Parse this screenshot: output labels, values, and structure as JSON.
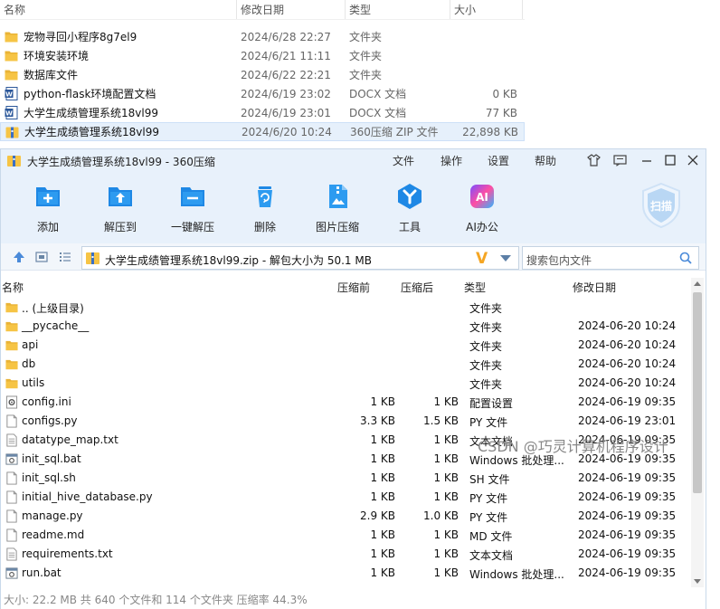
{
  "explorer": {
    "columns": [
      "名称",
      "修改日期",
      "类型",
      "大小"
    ],
    "rows": [
      {
        "name": "宠物寻回小程序8g7el9",
        "date": "2024/6/28 22:27",
        "type": "文件夹",
        "size": "",
        "icon": "folder-icon"
      },
      {
        "name": "环境安装环境",
        "date": "2024/6/21 11:11",
        "type": "文件夹",
        "size": "",
        "icon": "folder-icon"
      },
      {
        "name": "数据库文件",
        "date": "2024/6/22 22:21",
        "type": "文件夹",
        "size": "",
        "icon": "folder-icon"
      },
      {
        "name": "python-flask环境配置文档",
        "date": "2024/6/19 23:02",
        "type": "DOCX 文档",
        "size": "0 KB",
        "icon": "word-doc-icon"
      },
      {
        "name": "大学生成绩管理系统18vl99",
        "date": "2024/6/19 23:01",
        "type": "DOCX 文档",
        "size": "77 KB",
        "icon": "word-doc-icon"
      },
      {
        "name": "大学生成绩管理系统18vl99",
        "date": "2024/6/20 10:24",
        "type": "360压缩 ZIP 文件",
        "size": "22,898 KB",
        "icon": "zip-archive-icon",
        "selected": true
      }
    ]
  },
  "zip_window": {
    "title": "大学生成绩管理系统18vl99 - 360压缩",
    "menus": [
      "文件",
      "操作",
      "设置",
      "帮助"
    ],
    "toolbar": [
      {
        "label": "添加",
        "icon": "add-icon"
      },
      {
        "label": "解压到",
        "icon": "extract-to-icon"
      },
      {
        "label": "一键解压",
        "icon": "one-click-extract-icon"
      },
      {
        "label": "删除",
        "icon": "delete-icon"
      },
      {
        "label": "图片压缩",
        "icon": "image-compress-icon"
      },
      {
        "label": "工具",
        "icon": "tools-icon"
      },
      {
        "label": "AI办公",
        "icon": "ai-office-icon"
      }
    ],
    "scan_label": "扫描",
    "address": "大学生成绩管理系统18vl99.zip - 解包大小为 50.1 MB",
    "search_placeholder": "搜索包内文件",
    "list_columns": [
      "名称",
      "压缩前",
      "压缩后",
      "类型",
      "修改日期"
    ],
    "files": [
      {
        "name": ".. (上级目录)",
        "before": "",
        "after": "",
        "type": "文件夹",
        "date": "",
        "icon": "folder-icon"
      },
      {
        "name": "__pycache__",
        "before": "",
        "after": "",
        "type": "文件夹",
        "date": "2024-06-20 10:24",
        "icon": "folder-icon"
      },
      {
        "name": "api",
        "before": "",
        "after": "",
        "type": "文件夹",
        "date": "2024-06-20 10:24",
        "icon": "folder-icon"
      },
      {
        "name": "db",
        "before": "",
        "after": "",
        "type": "文件夹",
        "date": "2024-06-20 10:24",
        "icon": "folder-icon"
      },
      {
        "name": "utils",
        "before": "",
        "after": "",
        "type": "文件夹",
        "date": "2024-06-20 10:24",
        "icon": "folder-icon"
      },
      {
        "name": "config.ini",
        "before": "1 KB",
        "after": "1 KB",
        "type": "配置设置",
        "date": "2024-06-19 09:35",
        "icon": "config-file-icon"
      },
      {
        "name": "configs.py",
        "before": "3.3 KB",
        "after": "1.5 KB",
        "type": "PY 文件",
        "date": "2024-06-19 23:01",
        "icon": "file-icon"
      },
      {
        "name": "datatype_map.txt",
        "before": "1 KB",
        "after": "1 KB",
        "type": "文本文档",
        "date": "2024-06-19 09:35",
        "icon": "text-file-icon"
      },
      {
        "name": "init_sql.bat",
        "before": "1 KB",
        "after": "1 KB",
        "type": "Windows 批处理...",
        "date": "2024-06-19 09:35",
        "icon": "batch-file-icon"
      },
      {
        "name": "init_sql.sh",
        "before": "1 KB",
        "after": "1 KB",
        "type": "SH 文件",
        "date": "2024-06-19 09:35",
        "icon": "file-icon"
      },
      {
        "name": "initial_hive_database.py",
        "before": "1 KB",
        "after": "1 KB",
        "type": "PY 文件",
        "date": "2024-06-19 09:35",
        "icon": "file-icon"
      },
      {
        "name": "manage.py",
        "before": "2.9 KB",
        "after": "1.0 KB",
        "type": "PY 文件",
        "date": "2024-06-19 09:35",
        "icon": "file-icon"
      },
      {
        "name": "readme.md",
        "before": "1 KB",
        "after": "1 KB",
        "type": "MD 文件",
        "date": "2024-06-19 09:35",
        "icon": "file-icon"
      },
      {
        "name": "requirements.txt",
        "before": "1 KB",
        "after": "1 KB",
        "type": "文本文档",
        "date": "2024-06-19 09:35",
        "icon": "text-file-icon"
      },
      {
        "name": "run.bat",
        "before": "1 KB",
        "after": "1 KB",
        "type": "Windows 批处理...",
        "date": "2024-06-19 09:35",
        "icon": "batch-file-icon"
      }
    ],
    "status": "大小: 22.2 MB 共 640 个文件和 114 个文件夹 压缩率 44.3%"
  },
  "watermark": "CSDN @巧灵计算机程序设计",
  "colors": {
    "accent": "#1e88e5",
    "folder": "#f6c445",
    "toolbar_bg": "#e8f1fb",
    "selection": "#e6f0fb"
  }
}
